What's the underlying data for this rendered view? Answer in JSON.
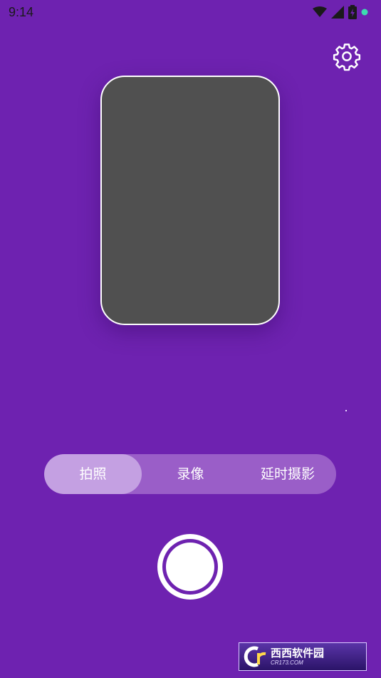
{
  "status_bar": {
    "time": "9:14",
    "icons": [
      "wifi-icon",
      "signal-icon",
      "battery-icon",
      "notification-dot-icon"
    ],
    "dot_color": "#3ddbb0"
  },
  "toolbar": {
    "settings_icon": "gear-icon"
  },
  "modes": {
    "photo": "拍照",
    "video": "录像",
    "timelapse": "延时摄影",
    "selected": "拍照"
  },
  "colors": {
    "background": "#6e22b0",
    "preview": "#505050",
    "mode_bar": "#9a5ec8",
    "mode_active": "#c4a0e2"
  },
  "watermark": {
    "logo": "Cr",
    "main": "西西软件园",
    "sub": "CR173.COM"
  }
}
